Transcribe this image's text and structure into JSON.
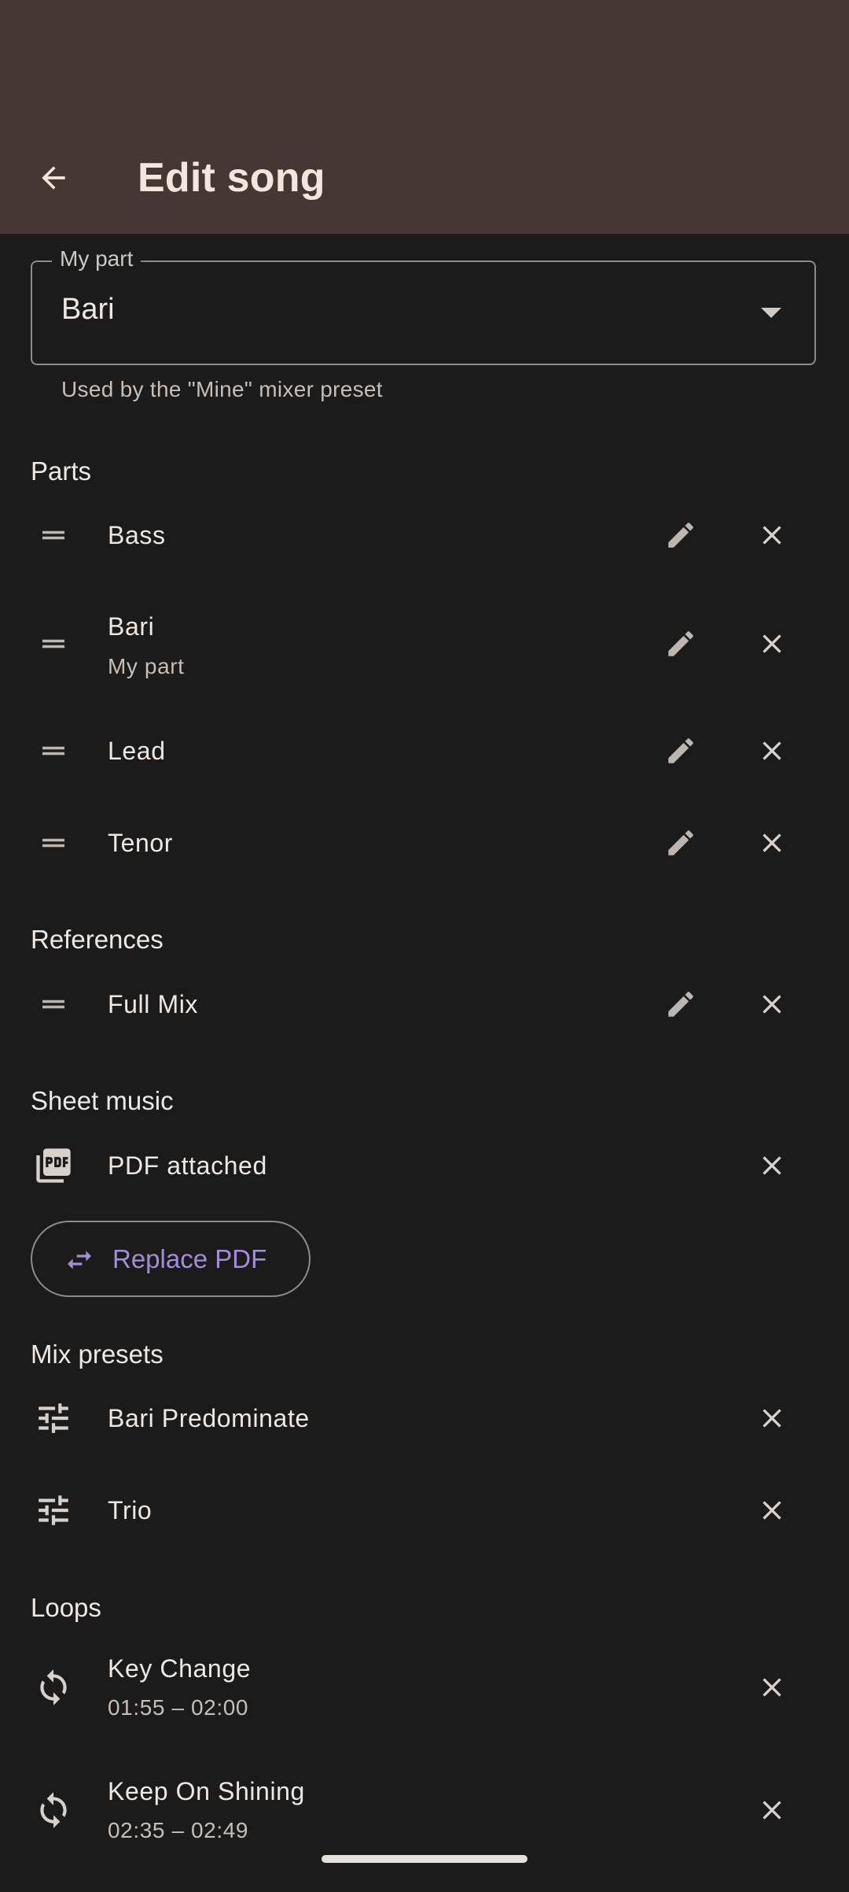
{
  "appbar": {
    "title": "Edit song"
  },
  "my_part": {
    "label": "My part",
    "value": "Bari",
    "helper": "Used by the \"Mine\" mixer preset"
  },
  "sections": {
    "parts": "Parts",
    "references": "References",
    "sheet_music": "Sheet music",
    "mix_presets": "Mix presets",
    "loops": "Loops"
  },
  "parts": [
    {
      "name": "Bass"
    },
    {
      "name": "Bari",
      "subtitle": "My part"
    },
    {
      "name": "Lead"
    },
    {
      "name": "Tenor"
    }
  ],
  "references": [
    {
      "name": "Full Mix"
    }
  ],
  "sheet_music": {
    "status": "PDF attached",
    "replace_label": "Replace PDF"
  },
  "mix_presets": [
    {
      "name": "Bari Predominate"
    },
    {
      "name": "Trio"
    }
  ],
  "loops": [
    {
      "name": "Key Change",
      "range": "01:55 – 02:00"
    },
    {
      "name": "Keep On Shining",
      "range": "02:35 – 02:49"
    }
  ],
  "icons": {
    "back": "arrow-back-icon",
    "drag": "drag-handle-icon",
    "edit": "pencil-icon",
    "remove": "close-icon",
    "pdf": "pdf-icon",
    "swap": "swap-horiz-icon",
    "tune": "tune-icon",
    "loop": "sync-icon"
  },
  "colors": {
    "appbar": "#463634",
    "background": "#1c1b1b",
    "accent": "#a58cd8"
  }
}
